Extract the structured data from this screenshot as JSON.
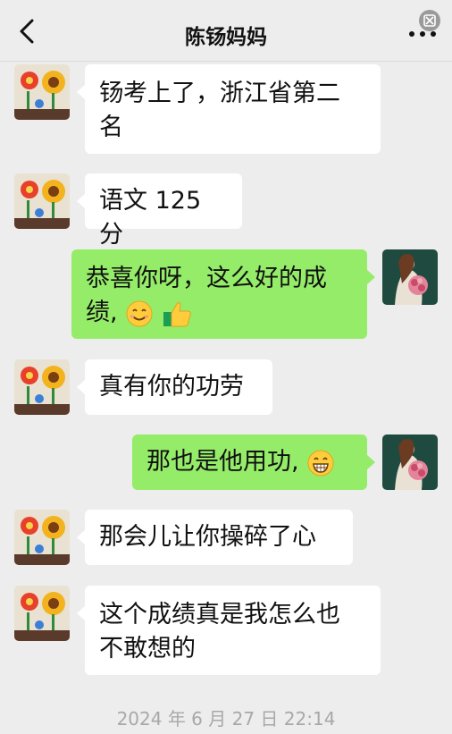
{
  "header": {
    "title": "陈钖妈妈",
    "back_icon": "chevron-left-icon",
    "more_icon": "more-dots-icon"
  },
  "messages": [
    {
      "side": "in",
      "text_line1": "钖考上了，浙江省第二",
      "text_line2": "名"
    },
    {
      "side": "in",
      "text": "语文 125 分"
    },
    {
      "side": "out",
      "text_line1": "恭喜你呀，这么好的成",
      "text_line2": "绩,",
      "emojis": [
        "smiling-face-emoji",
        "thumbs-up-emoji"
      ]
    },
    {
      "side": "in",
      "text": "真有你的功劳"
    },
    {
      "side": "out",
      "text": "那也是他用功,",
      "emojis": [
        "grinning-face-emoji"
      ]
    },
    {
      "side": "in",
      "text": "那会儿让你操碎了心"
    },
    {
      "side": "in",
      "text_line1": "这个成绩真是我怎么也",
      "text_line2": "不敢想的"
    }
  ],
  "timestamp": "2024 年 6 月 27 日  22:14",
  "colors": {
    "background": "#ededed",
    "incoming_bubble": "#ffffff",
    "outgoing_bubble": "#95ec69"
  }
}
